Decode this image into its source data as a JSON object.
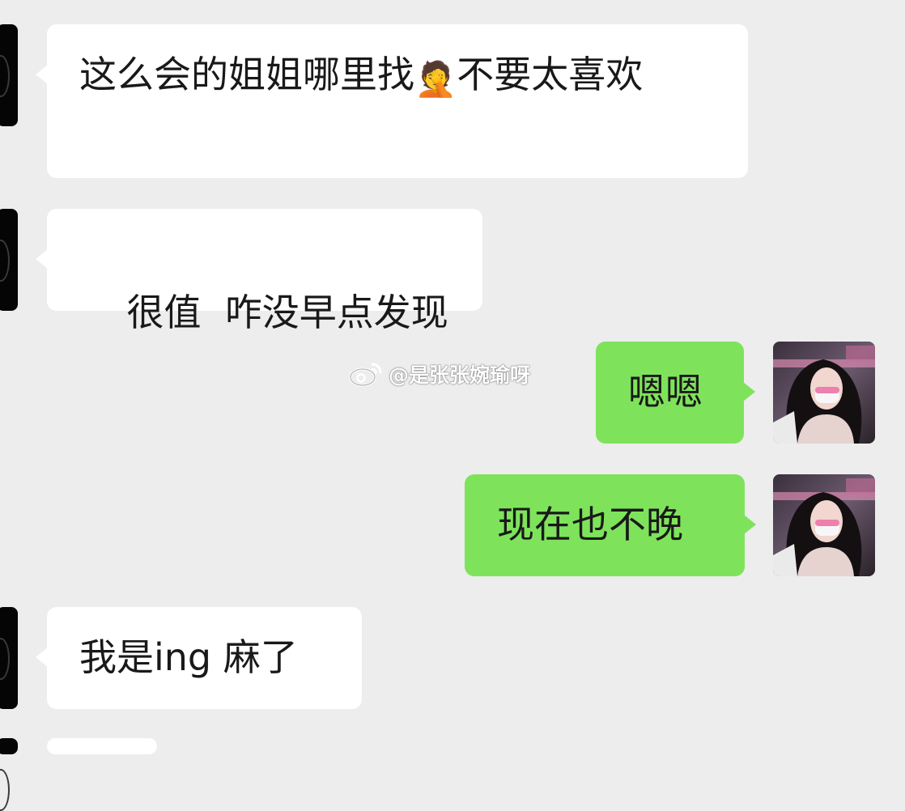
{
  "messages": [
    {
      "side": "incoming",
      "text_before": "这么会的姐姐哪里找",
      "emoji": "face-palm-crying-emoji",
      "text_after": "不要太喜欢"
    },
    {
      "side": "incoming",
      "text": "很值  咋没早点发现"
    },
    {
      "side": "outgoing",
      "text": "嗯嗯"
    },
    {
      "side": "outgoing",
      "text": "现在也不晚"
    },
    {
      "side": "incoming",
      "text": "我是ing 麻了"
    }
  ],
  "watermark": {
    "text": "@是张张婉瑜呀",
    "icon": "weibo-logo-icon"
  },
  "colors": {
    "background": "#ededed",
    "incoming_bubble": "#ffffff",
    "outgoing_bubble": "#7ee35b",
    "text": "#191919"
  }
}
